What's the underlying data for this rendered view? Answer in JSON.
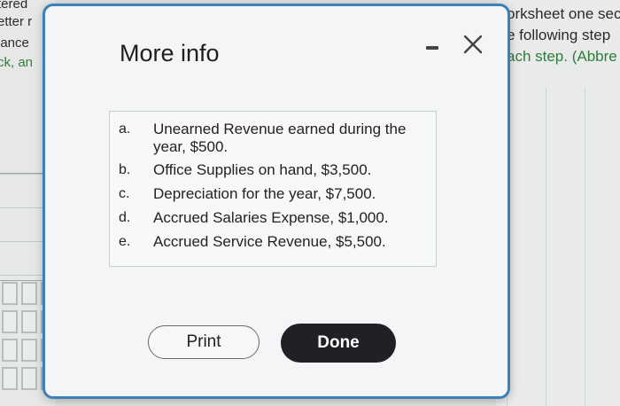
{
  "background": {
    "left_lines": [
      "tered",
      "etter r",
      "lance",
      "ck, an"
    ],
    "right_lines": [
      "orksheet one sec",
      "e following step",
      "ach step. (Abbre"
    ]
  },
  "modal": {
    "title": "More info",
    "items": [
      {
        "letter": "a.",
        "text": "Unearned Revenue earned during the year, $500."
      },
      {
        "letter": "b.",
        "text": "Office Supplies on hand, $3,500."
      },
      {
        "letter": "c.",
        "text": "Depreciation for the year, $7,500."
      },
      {
        "letter": "d.",
        "text": "Accrued Salaries Expense, $1,000."
      },
      {
        "letter": "e.",
        "text": "Accrued Service Revenue, $5,500."
      }
    ],
    "print_label": "Print",
    "done_label": "Done"
  },
  "colors": {
    "modal_border": "#3f7fb8",
    "done_button_bg": "#1f2124",
    "accent_green": "#2f7c3c"
  },
  "icons": [
    "minimize-icon",
    "close-icon"
  ]
}
